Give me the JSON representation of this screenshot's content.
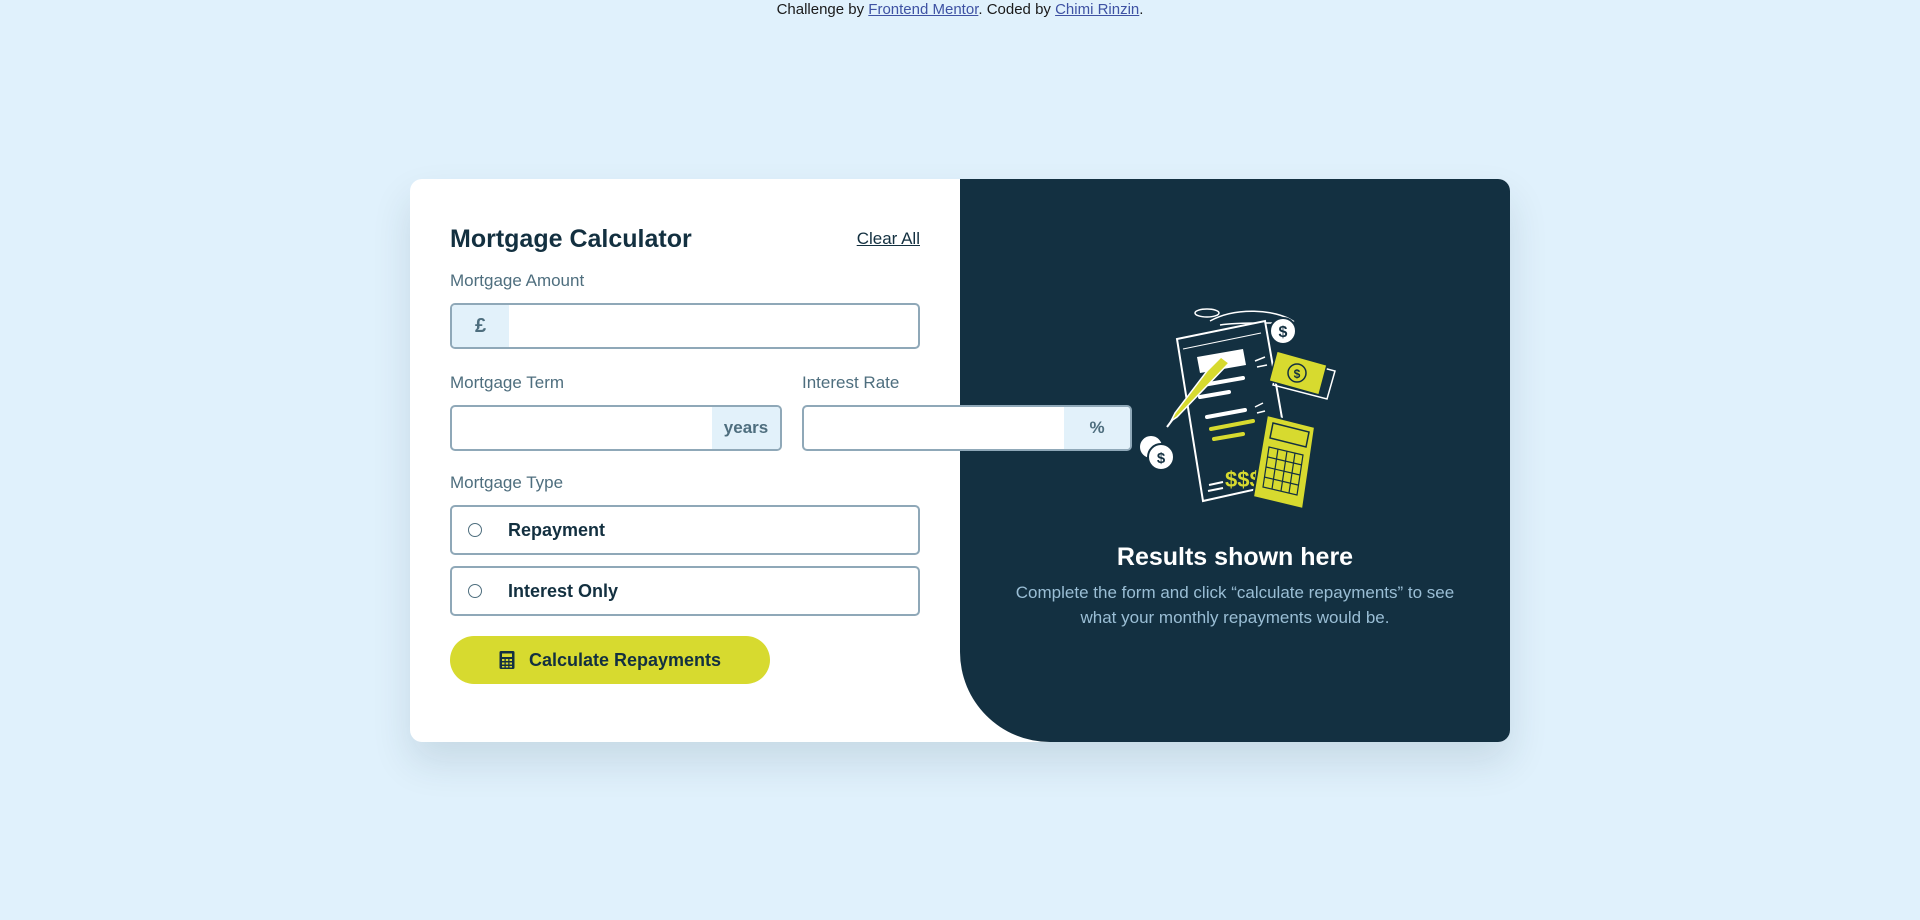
{
  "attribution": {
    "prefix": "Challenge by ",
    "challenge_link": "Frontend Mentor",
    "middle": ". Coded by ",
    "author_link": "Chimi Rinzin",
    "suffix": "."
  },
  "form": {
    "title": "Mortgage Calculator",
    "clear_label": "Clear All",
    "amount": {
      "label": "Mortgage Amount",
      "prefix": "£",
      "value": ""
    },
    "term": {
      "label": "Mortgage Term",
      "suffix": "years",
      "value": ""
    },
    "rate": {
      "label": "Interest Rate",
      "suffix": "%",
      "value": ""
    },
    "type": {
      "label": "Mortgage Type",
      "options": [
        {
          "label": "Repayment",
          "selected": false
        },
        {
          "label": "Interest Only",
          "selected": false
        }
      ]
    },
    "submit_label": "Calculate Repayments"
  },
  "results": {
    "title": "Results shown here",
    "description": "Complete the form and click “calculate repayments” to see what your monthly repayments would be."
  },
  "colors": {
    "page_bg": "#e0f1fc",
    "accent": "#d7da2f",
    "dark_panel": "#133041",
    "border": "#8fa8b8",
    "addon_bg": "#e2f1fa"
  }
}
